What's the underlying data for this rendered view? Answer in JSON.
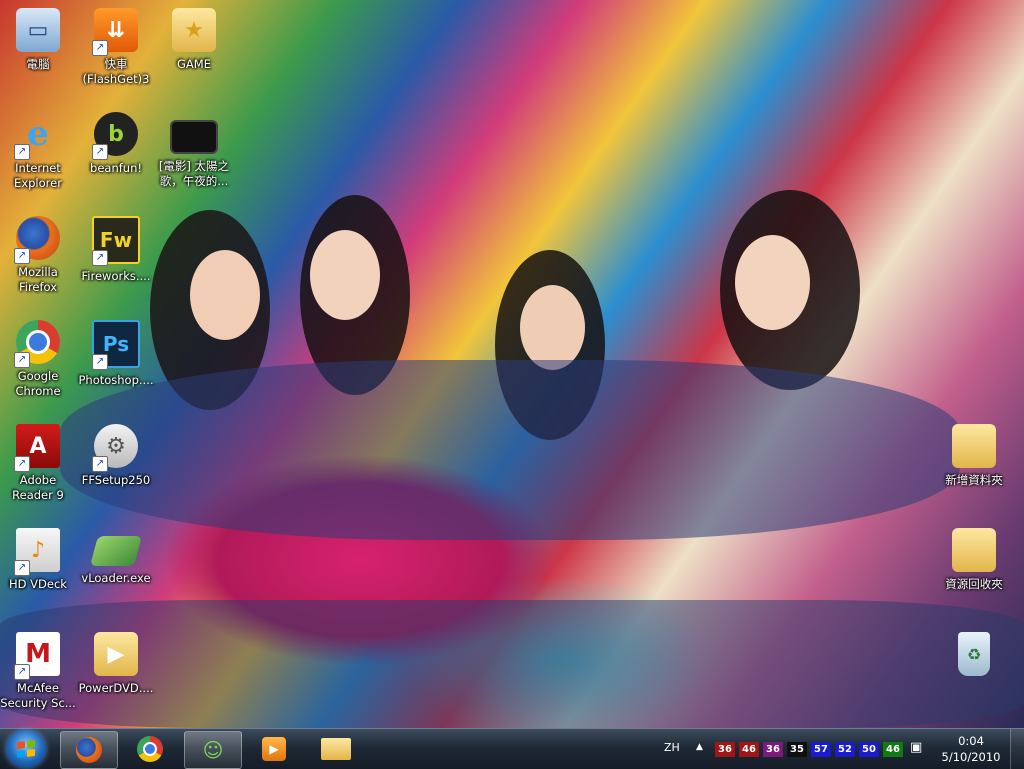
{
  "desktop": {
    "icons": [
      {
        "label": "電腦",
        "icon": "computer-icon",
        "shortcut": false
      },
      {
        "label": "快車(FlashGet)3",
        "icon": "flashget-icon",
        "shortcut": true
      },
      {
        "label": "GAME",
        "icon": "folder-icon",
        "shortcut": false
      },
      {
        "label": "Internet Explorer",
        "icon": "internet-explorer-icon",
        "shortcut": true
      },
      {
        "label": "beanfun!",
        "icon": "beanfun-icon",
        "shortcut": true
      },
      {
        "label": "[電影] 太陽之歌，午夜的...",
        "icon": "video-file-icon",
        "shortcut": false
      },
      {
        "label": "Mozilla Firefox",
        "icon": "firefox-icon",
        "shortcut": true
      },
      {
        "label": "Fireworks....",
        "icon": "fireworks-icon",
        "shortcut": true
      },
      {
        "label": "Google Chrome",
        "icon": "chrome-icon",
        "shortcut": true
      },
      {
        "label": "Photoshop....",
        "icon": "photoshop-icon",
        "shortcut": true
      },
      {
        "label": "Adobe Reader 9",
        "icon": "adobe-reader-icon",
        "shortcut": true
      },
      {
        "label": "FFSetup250",
        "icon": "ffsetup-icon",
        "shortcut": true
      },
      {
        "label": "HD VDeck",
        "icon": "hd-vdeck-icon",
        "shortcut": true
      },
      {
        "label": "vLoader.exe",
        "icon": "vloader-icon",
        "shortcut": false
      },
      {
        "label": "McAfee Security Sc...",
        "icon": "mcafee-icon",
        "shortcut": true
      },
      {
        "label": "PowerDVD....",
        "icon": "powerdvd-folder-icon",
        "shortcut": false
      },
      {
        "label": "新增資料夾",
        "icon": "folder-icon",
        "shortcut": false
      },
      {
        "label": "資源回收夾",
        "icon": "folder-icon",
        "shortcut": false
      },
      {
        "label": "",
        "icon": "recycle-bin-icon",
        "shortcut": false
      }
    ]
  },
  "taskbar": {
    "start_icon": "windows-logo-icon",
    "pinned": [
      {
        "icon": "firefox-icon",
        "active": true
      },
      {
        "icon": "chrome-icon",
        "active": false
      },
      {
        "icon": "network-users-icon",
        "active": true
      },
      {
        "icon": "media-player-icon",
        "active": false
      },
      {
        "icon": "explorer-folder-icon",
        "active": false
      }
    ],
    "tray": {
      "language": "ZH",
      "indicators": [
        {
          "value": "36",
          "bg": "#a01616"
        },
        {
          "value": "46",
          "bg": "#a01616"
        },
        {
          "value": "36",
          "bg": "#7a1a7a"
        },
        {
          "value": "35",
          "bg": "#101010"
        },
        {
          "value": "57",
          "bg": "#1a1ad0"
        },
        {
          "value": "52",
          "bg": "#1a1ad0"
        },
        {
          "value": "50",
          "bg": "#1a1ad0"
        },
        {
          "value": "46",
          "bg": "#127a12"
        }
      ],
      "time": "0:04",
      "date": "5/10/2010"
    }
  }
}
